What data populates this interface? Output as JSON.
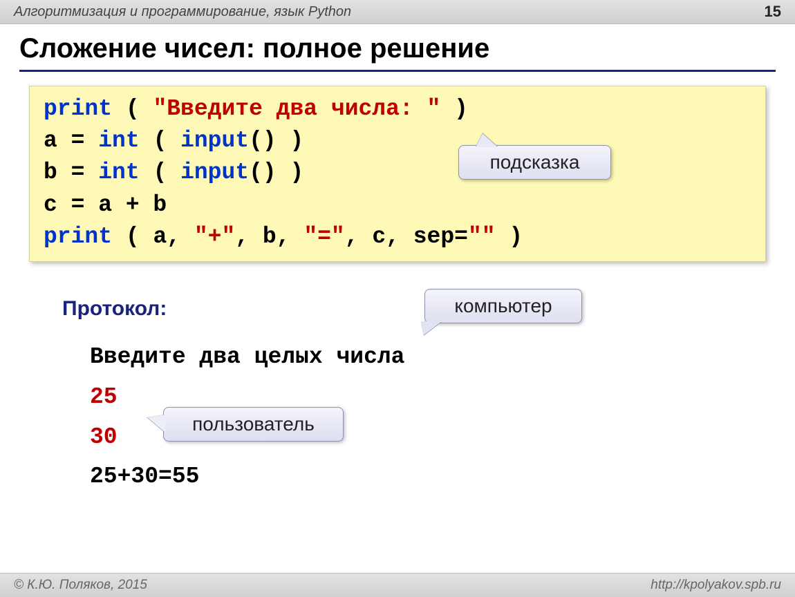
{
  "header": {
    "topic": "Алгоритмизация и программирование, язык Python",
    "page": "15"
  },
  "title": "Сложение чисел: полное решение",
  "code": {
    "line1": {
      "kw": "print",
      "open": " ( ",
      "str": "\"Введите два числа: \"",
      "close": " )"
    },
    "line2": {
      "lhs": "a = ",
      "kw": "int",
      "open": " ( ",
      "fn": "input",
      "call": "()",
      "close": " )"
    },
    "line3": {
      "lhs": "b = ",
      "kw": "int",
      "open": " ( ",
      "fn": "input",
      "call": "()",
      "close": " )"
    },
    "line4": "c = a + b",
    "line5": {
      "kw": "print",
      "open": " ( a, ",
      "s1": "\"+\"",
      "m1": ", b, ",
      "s2": "\"=\"",
      "m2": ", c, sep=",
      "s3": "\"\"",
      "close": " )"
    }
  },
  "callouts": {
    "hint": "подсказка",
    "computer": "компьютер",
    "user": "пользователь"
  },
  "protocol": {
    "label": "Протокол:",
    "prompt": "Введите два целых числа",
    "input1": "25",
    "input2": "30",
    "result": "25+30=55"
  },
  "footer": {
    "author": "© К.Ю. Поляков, 2015",
    "url": "http://kpolyakov.spb.ru"
  }
}
